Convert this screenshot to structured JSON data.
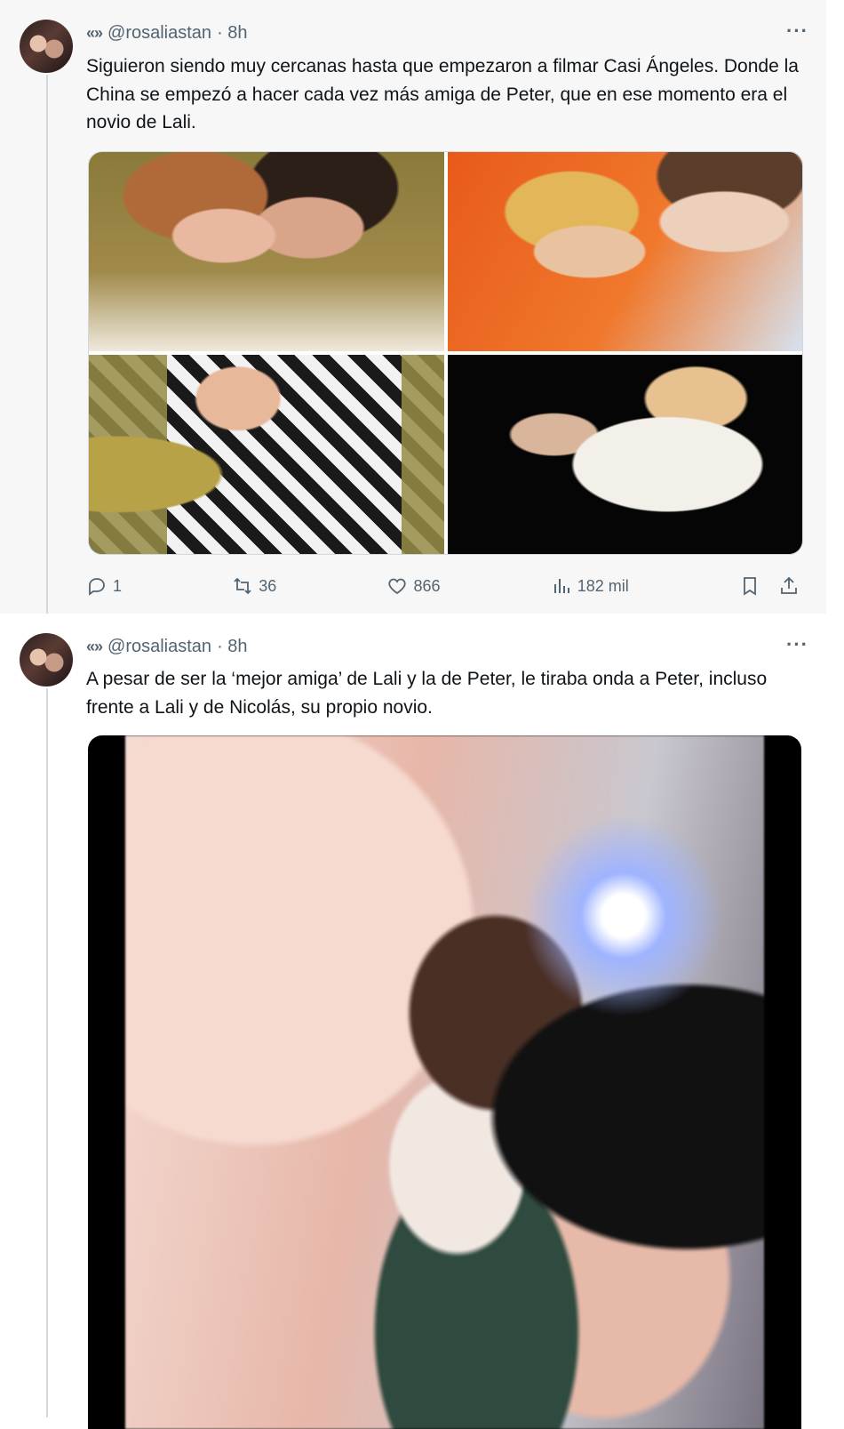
{
  "tweets": [
    {
      "author_glyph": "«»",
      "handle": "@rosaliastan",
      "time": "· 8h",
      "more": "···",
      "text": "Siguieron siendo muy cercanas hasta que empezaron a filmar Casi Ángeles. Donde la China se empezó a hacer cada vez más amiga de Peter, que en ese momento era el novio de Lali.",
      "stats": {
        "replies": "1",
        "retweets": "36",
        "likes": "866",
        "views": "182 mil"
      }
    },
    {
      "author_glyph": "«»",
      "handle": "@rosaliastan",
      "time": "· 8h",
      "more": "···",
      "text": "A pesar de ser la ‘mejor amiga’ de Lali y la de Peter, le tiraba onda a Peter, incluso frente a Lali y de Nicolás, su propio novio."
    }
  ],
  "colors": {
    "muted": "#536471",
    "text": "#0f1419",
    "border": "#cfd9de"
  }
}
